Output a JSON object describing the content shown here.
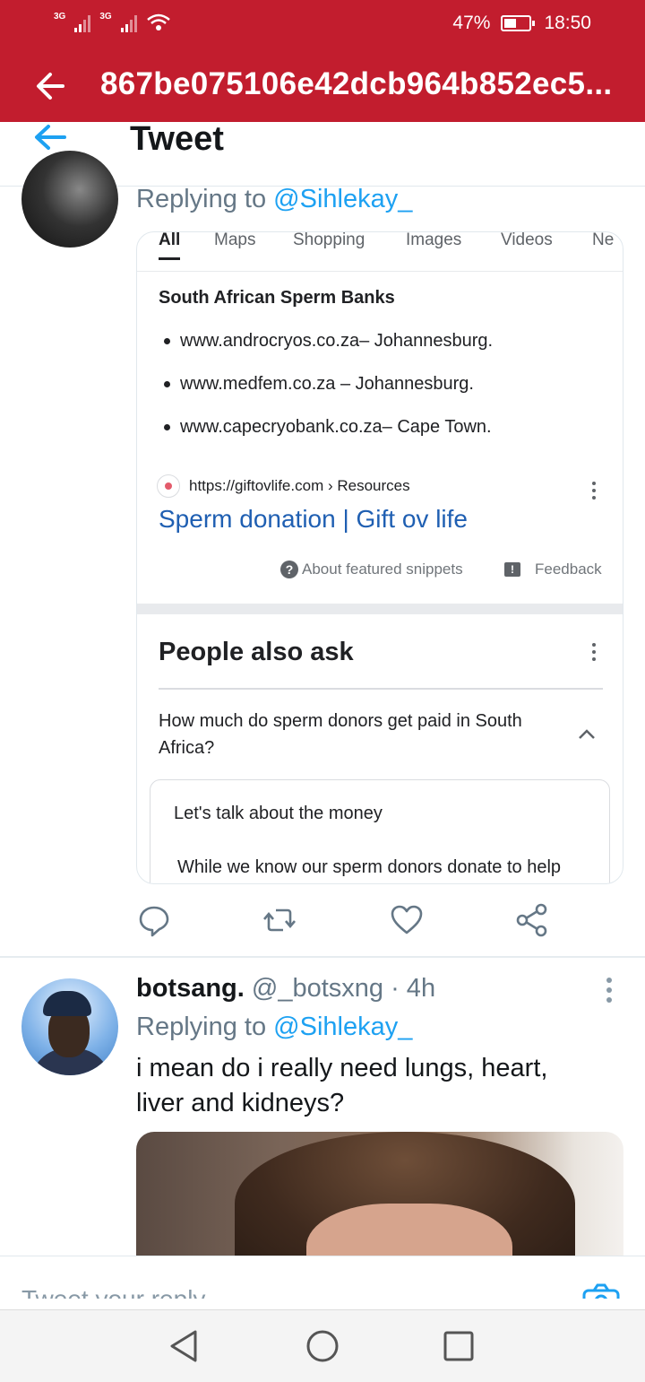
{
  "status_bar": {
    "network1": "3G",
    "network2": "3G",
    "battery": "47%",
    "time": "18:50"
  },
  "app_bar": {
    "title": "867be075106e42dcb964b852ec5..."
  },
  "tweet_header": {
    "title": "Tweet"
  },
  "tweet1": {
    "replying_prefix": "Replying to ",
    "replying_handle": "@Sihlekay_"
  },
  "search_card": {
    "tabs": [
      "All",
      "Maps",
      "Shopping",
      "Images",
      "Videos",
      "Ne"
    ],
    "snippet_title": "South African Sperm Banks",
    "banks": [
      "www.androcryos.co.za– Johannesburg.",
      "www.medfem.co.za – Johannesburg.",
      "www.capecryobank.co.za– Cape Town."
    ],
    "source_url": "https://giftovlife.com › Resources",
    "result_link": "Sperm donation | Gift ov life",
    "about_snippets": "About featured snippets",
    "feedback": "Feedback",
    "paa_title": "People also ask",
    "paa_question": "How much do sperm donors get paid in South Africa?",
    "answer_heading": "Let's talk about the money",
    "answer_text": "While we know our sperm donors donate to help"
  },
  "tweet2": {
    "name": "botsang.",
    "handle_time": " @_botsxng · 4h",
    "replying_prefix": "Replying to ",
    "replying_handle": "@Sihlekay_",
    "text": "i mean do i really need lungs, heart, liver and kidneys?"
  },
  "composer": {
    "placeholder": "Tweet your reply"
  },
  "colors": {
    "brand_red": "#c21d2e",
    "twitter_blue": "#1da1f2",
    "link_blue": "#1f5fb2"
  }
}
